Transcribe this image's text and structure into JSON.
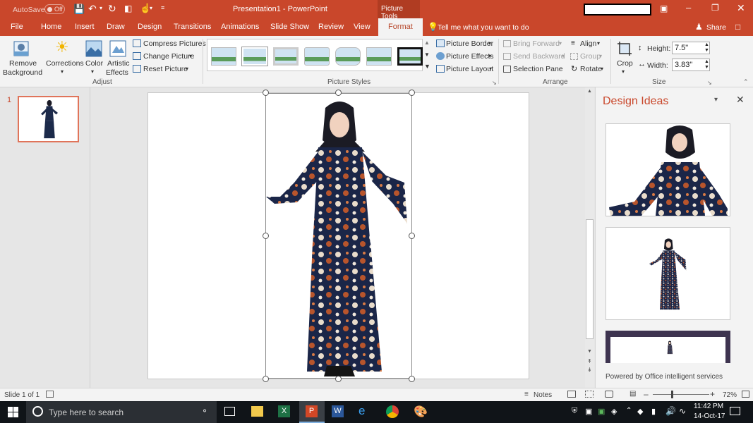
{
  "titlebar": {
    "autosave_label": "AutoSave",
    "autosave_state": "Off",
    "title": "Presentation1 - PowerPoint",
    "context_tab": "Picture Tools"
  },
  "tabs": [
    "File",
    "Home",
    "Insert",
    "Draw",
    "Design",
    "Transitions",
    "Animations",
    "Slide Show",
    "Review",
    "View",
    "Format"
  ],
  "tell_me": "Tell me what you want to do",
  "share": "Share",
  "ribbon": {
    "remove_background": [
      "Remove",
      "Background"
    ],
    "corrections": "Corrections",
    "color": "Color",
    "artistic_effects": [
      "Artistic",
      "Effects"
    ],
    "compress": "Compress Pictures",
    "change_picture": "Change Picture",
    "reset_picture": "Reset Picture",
    "group_adjust": "Adjust",
    "group_styles": "Picture Styles",
    "picture_border": "Picture Border",
    "picture_effects": "Picture Effects",
    "picture_layout": "Picture Layout",
    "bring_forward": "Bring Forward",
    "send_backward": "Send Backward",
    "selection_pane": "Selection Pane",
    "align": "Align",
    "group": "Group",
    "rotate": "Rotate",
    "group_arrange": "Arrange",
    "crop": "Crop",
    "height_label": "Height:",
    "height_value": "7.5\"",
    "width_label": "Width:",
    "width_value": "3.83\"",
    "group_size": "Size"
  },
  "thumbnails": {
    "number": "1"
  },
  "design_ideas": {
    "title": "Design Ideas",
    "powered_by": "Powered by Office intelligent services"
  },
  "status": {
    "slide_info": "Slide 1 of 1",
    "notes": "Notes",
    "zoom": "72%"
  },
  "taskbar": {
    "search_placeholder": "Type here to search",
    "time": "11:42 PM",
    "date": "14-Oct-17"
  },
  "colors": {
    "accent": "#c9472b",
    "ribbon": "#f3f3f3",
    "taskbar": "#101418"
  }
}
